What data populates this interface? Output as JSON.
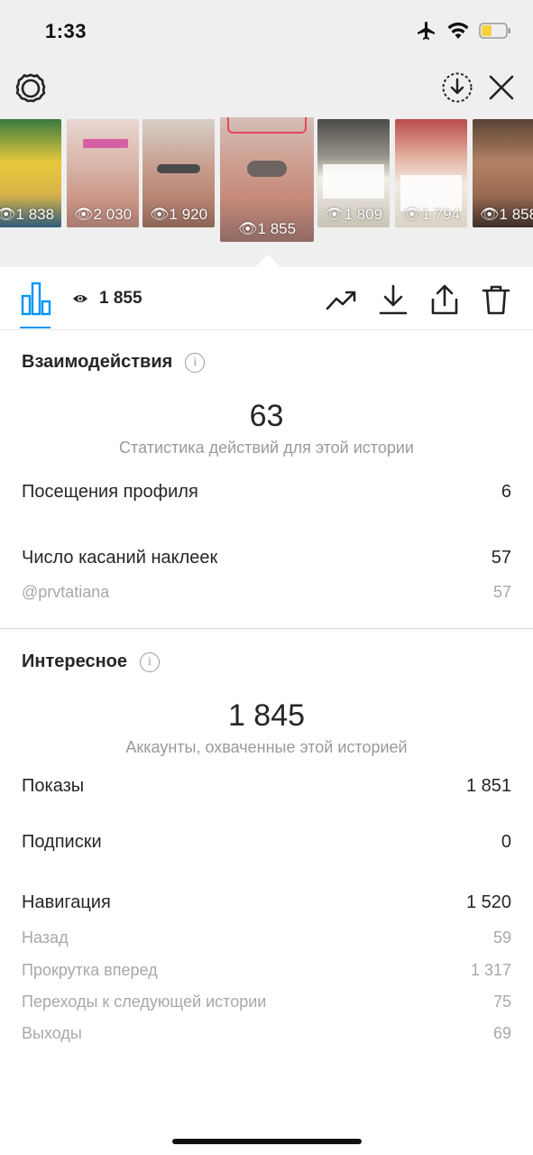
{
  "status_bar": {
    "time": "1:33"
  },
  "thumbnails": [
    {
      "views": "1 838",
      "bg": "#c7b15a"
    },
    {
      "views": "2 030",
      "bg": "#d9b9b2"
    },
    {
      "views": "1 920",
      "bg": "#cba99b"
    },
    {
      "views": "1 855",
      "bg": "#c89a8f",
      "selected": true
    },
    {
      "views": "1 809",
      "bg": "#8f8a80"
    },
    {
      "views": "1 794",
      "bg": "#d3aaa0"
    },
    {
      "views": "1 858",
      "bg": "#8b6a56"
    }
  ],
  "action_bar": {
    "views": "1 855"
  },
  "interactions": {
    "title": "Взаимодействия",
    "total": "63",
    "caption": "Статистика действий для этой истории",
    "profile_visits_label": "Посещения профиля",
    "profile_visits_value": "6",
    "sticker_taps_label": "Число касаний наклеек",
    "sticker_taps_value": "57",
    "mention_label": "@prvtatiana",
    "mention_value": "57"
  },
  "discovery": {
    "title": "Интересное",
    "total": "1 845",
    "caption": "Аккаунты, охваченные этой историей",
    "impressions_label": "Показы",
    "impressions_value": "1 851",
    "follows_label": "Подписки",
    "follows_value": "0",
    "navigation_label": "Навигация",
    "navigation_value": "1 520",
    "back_label": "Назад",
    "back_value": "59",
    "forward_label": "Прокрутка вперед",
    "forward_value": "1 317",
    "next_story_label": "Переходы к следующей истории",
    "next_story_value": "75",
    "exits_label": "Выходы",
    "exits_value": "69"
  },
  "colors": {
    "accent": "#0095f6",
    "muted": "#9a9a9a",
    "text": "#262626",
    "battery": "#f5d23b"
  },
  "icons": [
    "airplane-icon",
    "wifi-icon",
    "battery-icon",
    "gear-icon",
    "download-circle-icon",
    "close-icon",
    "bar-chart-icon",
    "eye-icon",
    "trend-icon",
    "download-icon",
    "share-icon",
    "trash-icon",
    "info-icon"
  ]
}
